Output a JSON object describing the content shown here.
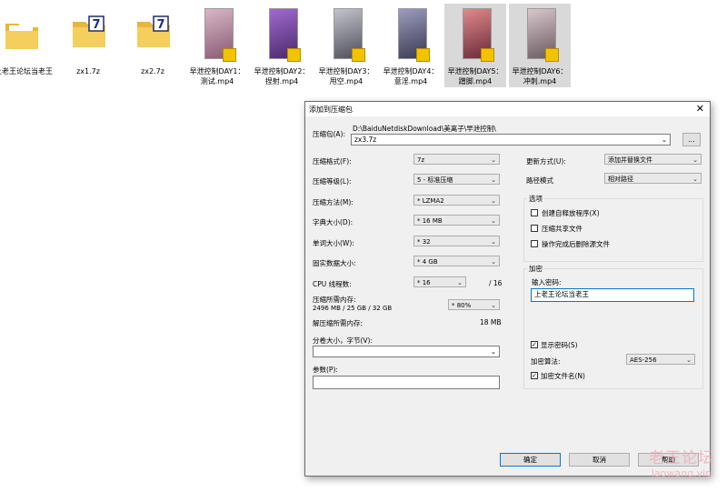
{
  "files": [
    {
      "name": "上老王论坛当老王",
      "type": "folder"
    },
    {
      "name": "zx1.7z",
      "type": "7z"
    },
    {
      "name": "zx2.7z",
      "type": "7z"
    },
    {
      "name": "早泄控制DAY1：测试.mp4",
      "line1": "早泄控制DAY1：",
      "line2": "测试.mp4",
      "type": "video",
      "thumb": "#b88aa0",
      "selected": false
    },
    {
      "name": "早泄控制DAY2：捏射.mp4",
      "line1": "早泄控制DAY2：",
      "line2": "捏射.mp4",
      "type": "video",
      "thumb": "#7d5aa8",
      "selected": false
    },
    {
      "name": "早泄控制DAY3：甩空.mp4",
      "line1": "早泄控制DAY3：",
      "line2": "甩空.mp4",
      "type": "video",
      "thumb": "#8e8e9a",
      "selected": false
    },
    {
      "name": "早泄控制DAY4：意淫.mp4",
      "line1": "早泄控制DAY4：",
      "line2": "意淫.mp4",
      "type": "video",
      "thumb": "#6a6a80",
      "selected": false
    },
    {
      "name": "早泄控制DAY5：蹭脚.mp4",
      "line1": "早泄控制DAY5：",
      "line2": "蹭脚.mp4",
      "type": "video",
      "thumb": "#c07a80",
      "selected": true
    },
    {
      "name": "早泄控制DAY6：冲刺.mp4",
      "line1": "早泄控制DAY6：",
      "line2": "冲刺.mp4",
      "type": "video",
      "thumb": "#9a8a90",
      "selected": true
    }
  ],
  "dialog": {
    "title": "添加到压缩包",
    "close": "✕",
    "archive_label": "压缩包(A):",
    "archive_dir": "D:\\BaiduNetdiskDownload\\美离子\\早泄控制\\",
    "archive_name": "zx3.7z",
    "browse": "...",
    "format_label": "压缩格式(F):",
    "format_value": "7z",
    "level_label": "压缩等级(L):",
    "level_value": "5 - 标准压缩",
    "method_label": "压缩方法(M):",
    "method_value": "* LZMA2",
    "dict_label": "字典大小(D):",
    "dict_value": "* 16 MB",
    "word_label": "单词大小(W):",
    "word_value": "* 32",
    "solid_label": "固实数据大小:",
    "solid_value": "* 4 GB",
    "cpu_label": "CPU 线程数:",
    "cpu_value": "* 16",
    "cpu_total": "/ 16",
    "mem_label": "压缩所需内存:",
    "mem_detail": "2496 MB / 25 GB / 32 GB",
    "mem_value": "* 80%",
    "dmem_label": "解压缩所需内存:",
    "dmem_value": "18 MB",
    "split_label": "分卷大小，字节(V):",
    "split_value": "",
    "params_label": "参数(P):",
    "params_value": "",
    "update_label": "更新方式(U):",
    "update_value": "添加并替换文件",
    "path_label": "路径模式",
    "path_value": "相对路径",
    "options_title": "选项",
    "opt_sfx": "创建自释放程序(X)",
    "opt_shared": "压缩共享文件",
    "opt_delete": "操作完成后删除源文件",
    "enc_title": "加密",
    "pwd_label": "输入密码:",
    "pwd_value": "上老王论坛当老王",
    "show_pwd": "显示密码(S)",
    "enc_method_label": "加密算法:",
    "enc_method_value": "AES-256",
    "enc_names": "加密文件名(N)",
    "ok": "确定",
    "cancel": "取消",
    "help": "帮助"
  },
  "watermark": {
    "line1": "老王论坛",
    "line2": "laowang.vip"
  }
}
